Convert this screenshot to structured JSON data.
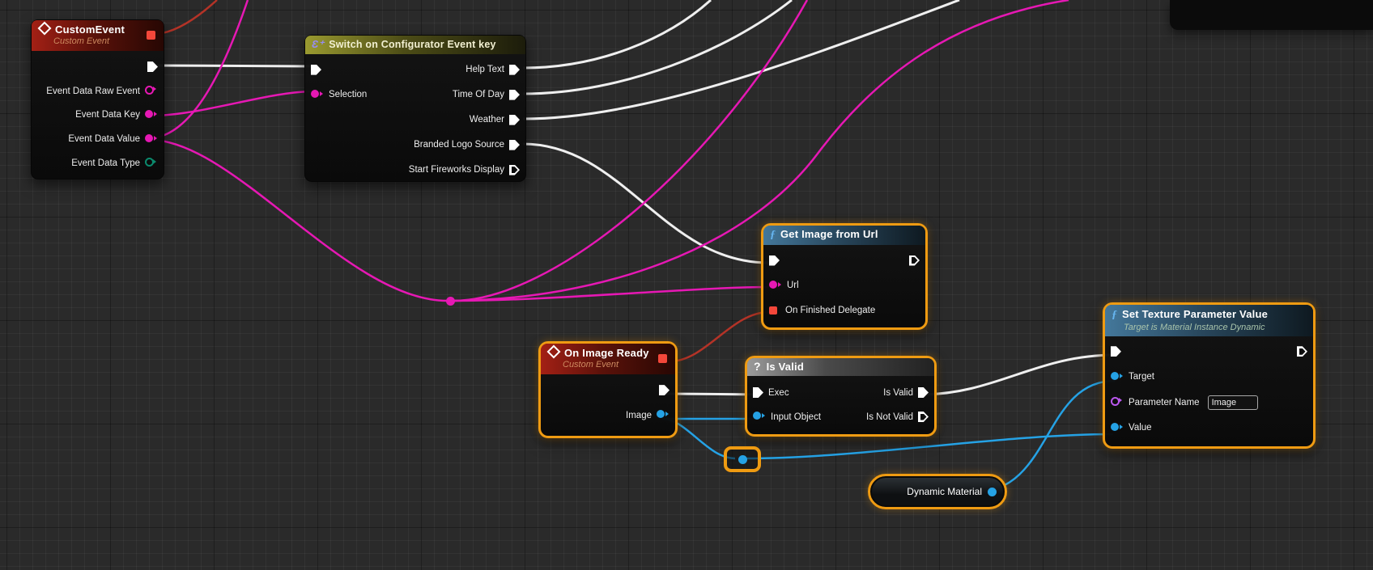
{
  "editor": "blueprint-graph",
  "colors": {
    "grid_bg": "#2a2a2a",
    "selection_orange": "#ef9b12",
    "exec_wire": "#efefef",
    "string_pin": "#e618b4",
    "object_pin": "#25a2e5",
    "enum_pin": "#0b8a6d",
    "name_pin": "#bb58ef",
    "delegate_pin": "#f4473a",
    "delegate_wire": "#b43327"
  },
  "nodes": {
    "custom_event": {
      "title": "CustomEvent",
      "subtitle": "Custom Event",
      "pins": {
        "raw": "Event Data Raw Event",
        "key": "Event Data Key",
        "value": "Event Data Value",
        "type": "Event Data Type"
      }
    },
    "switch": {
      "title": "Switch on Configurator Event key",
      "pins": {
        "selection": "Selection",
        "help_text": "Help Text",
        "time_of_day": "Time Of Day",
        "weather": "Weather",
        "branded_logo": "Branded Logo Source",
        "fireworks": "Start Fireworks Display"
      }
    },
    "get_image": {
      "title": "Get Image from Url",
      "pins": {
        "url": "Url",
        "on_finished": "On Finished Delegate"
      }
    },
    "on_image_ready": {
      "title": "On Image Ready",
      "subtitle": "Custom Event",
      "pins": {
        "image": "Image"
      }
    },
    "is_valid": {
      "title": "Is Valid",
      "pins": {
        "exec": "Exec",
        "input_object": "Input Object",
        "is_valid": "Is Valid",
        "is_not_valid": "Is Not Valid"
      }
    },
    "set_texture": {
      "title": "Set Texture Parameter Value",
      "subtitle": "Target is Material Instance Dynamic",
      "pins": {
        "target": "Target",
        "parameter_name": "Parameter Name",
        "value": "Value"
      },
      "parameter_name_value": "Image"
    },
    "dynamic_material": {
      "label": "Dynamic Material"
    }
  }
}
